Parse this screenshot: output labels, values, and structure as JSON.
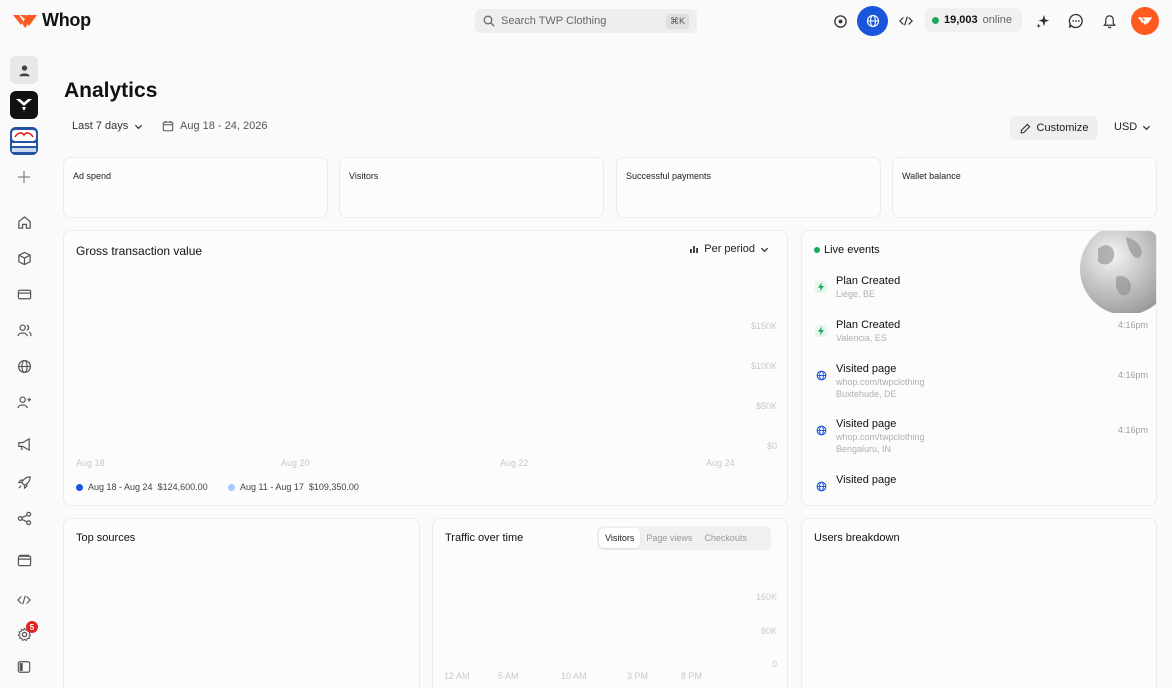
{
  "app": {
    "name": "Whop",
    "search_placeholder": "Search TWP Clothing",
    "search_shortcut": "⌘K",
    "online_count": "19,003",
    "online_label": "online",
    "accent_color": "#ff5a1f",
    "globe_color": "#1a56db",
    "settings_badge": "5"
  },
  "header": {
    "title": "Analytics",
    "range_label": "Last 7 days",
    "date_range": "Aug 18 - 24, 2026",
    "customize_label": "Customize",
    "currency": "USD"
  },
  "stat_cards": [
    {
      "label": "Ad spend"
    },
    {
      "label": "Visitors"
    },
    {
      "label": "Successful payments"
    },
    {
      "label": "Wallet balance"
    }
  ],
  "gtv": {
    "title": "Gross transaction value",
    "period_label": "Per period",
    "y_ticks": [
      "$150K",
      "$100K",
      "$50K",
      "$0"
    ],
    "x_ticks": [
      "Aug 18",
      "Aug 20",
      "Aug 22",
      "Aug 24"
    ],
    "legend": [
      {
        "label": "Aug 18 - Aug 24",
        "value": "$124,600.00",
        "color": "#1a56db"
      },
      {
        "label": "Aug 11 - Aug 17",
        "value": "$109,350.00",
        "color": "#a4c8ff"
      }
    ]
  },
  "live_events": {
    "title": "Live events",
    "items": [
      {
        "title": "Plan Created",
        "lines": [
          "Liège, BE"
        ],
        "time": "",
        "icon": "bolt-icon"
      },
      {
        "title": "Plan Created",
        "lines": [
          "Valencia, ES"
        ],
        "time": "4:16pm",
        "icon": "bolt-icon"
      },
      {
        "title": "Visited page",
        "lines": [
          "whop.com/twpclothing",
          "Buxtehude, DE"
        ],
        "time": "4:16pm",
        "icon": "globe-icon"
      },
      {
        "title": "Visited page",
        "lines": [
          "whop.com/twpclothing",
          "Bengaluru, IN"
        ],
        "time": "4:16pm",
        "icon": "globe-icon"
      },
      {
        "title": "Visited page",
        "lines": [],
        "time": "",
        "icon": "globe-icon"
      }
    ]
  },
  "top_sources": {
    "title": "Top sources"
  },
  "traffic": {
    "title": "Traffic over time",
    "tabs": [
      "Visitors",
      "Page views",
      "Checkouts"
    ],
    "active_tab": "Visitors",
    "y_ticks": [
      "160K",
      "80K",
      "0"
    ],
    "x_ticks": [
      "12 AM",
      "5 AM",
      "10 AM",
      "3 PM",
      "8 PM"
    ]
  },
  "users_breakdown": {
    "title": "Users breakdown"
  }
}
